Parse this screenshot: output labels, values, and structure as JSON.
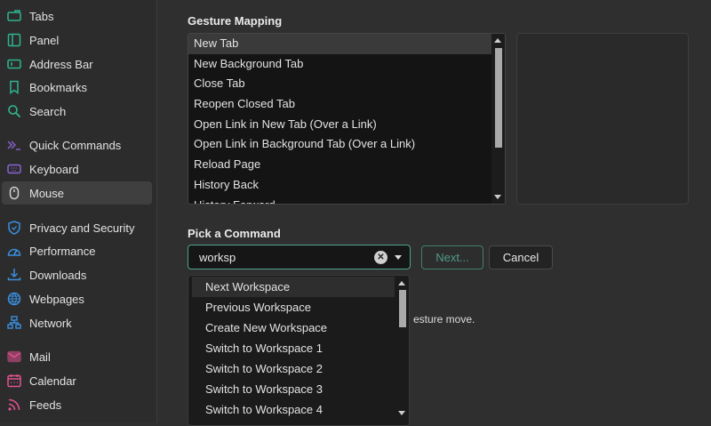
{
  "sidebar": {
    "items": [
      {
        "label": "Tabs",
        "icon": "tabs-icon",
        "color": "#2fb58e"
      },
      {
        "label": "Panel",
        "icon": "panel-icon",
        "color": "#2fb58e"
      },
      {
        "label": "Address Bar",
        "icon": "address-bar-icon",
        "color": "#2fb58e"
      },
      {
        "label": "Bookmarks",
        "icon": "bookmark-icon",
        "color": "#2fb58e"
      },
      {
        "label": "Search",
        "icon": "search-icon",
        "color": "#2fb58e"
      },
      {
        "label": "Quick Commands",
        "icon": "quick-commands-icon",
        "color": "#8a63d2"
      },
      {
        "label": "Keyboard",
        "icon": "keyboard-icon",
        "color": "#8a63d2"
      },
      {
        "label": "Mouse",
        "icon": "mouse-icon",
        "color": "#cfcfcf",
        "selected": true
      },
      {
        "label": "Privacy and Security",
        "icon": "shield-icon",
        "color": "#3a8fe0"
      },
      {
        "label": "Performance",
        "icon": "gauge-icon",
        "color": "#3a8fe0"
      },
      {
        "label": "Downloads",
        "icon": "download-icon",
        "color": "#3a8fe0"
      },
      {
        "label": "Webpages",
        "icon": "globe-icon",
        "color": "#3a8fe0"
      },
      {
        "label": "Network",
        "icon": "network-icon",
        "color": "#3a8fe0"
      },
      {
        "label": "Mail",
        "icon": "mail-icon",
        "color": "#e0528f"
      },
      {
        "label": "Calendar",
        "icon": "calendar-icon",
        "color": "#e0528f"
      },
      {
        "label": "Feeds",
        "icon": "feeds-icon",
        "color": "#e0528f"
      }
    ]
  },
  "gesture": {
    "heading": "Gesture Mapping",
    "items": [
      "New Tab",
      "New Background Tab",
      "Close Tab",
      "Reopen Closed Tab",
      "Open Link in New Tab (Over a Link)",
      "Open Link in Background Tab (Over a Link)",
      "Reload Page",
      "History Back",
      "History Forward"
    ],
    "selected": 0
  },
  "command": {
    "heading": "Pick a Command",
    "value": "worksp",
    "next_label": "Next...",
    "cancel_label": "Cancel",
    "hint": "esture move.",
    "options": [
      "Next Workspace",
      "Previous Workspace",
      "Create New Workspace",
      "Switch to Workspace 1",
      "Switch to Workspace 2",
      "Switch to Workspace 3",
      "Switch to Workspace 4"
    ],
    "highlighted": 0
  },
  "colors": {
    "accent": "#4da38f"
  }
}
